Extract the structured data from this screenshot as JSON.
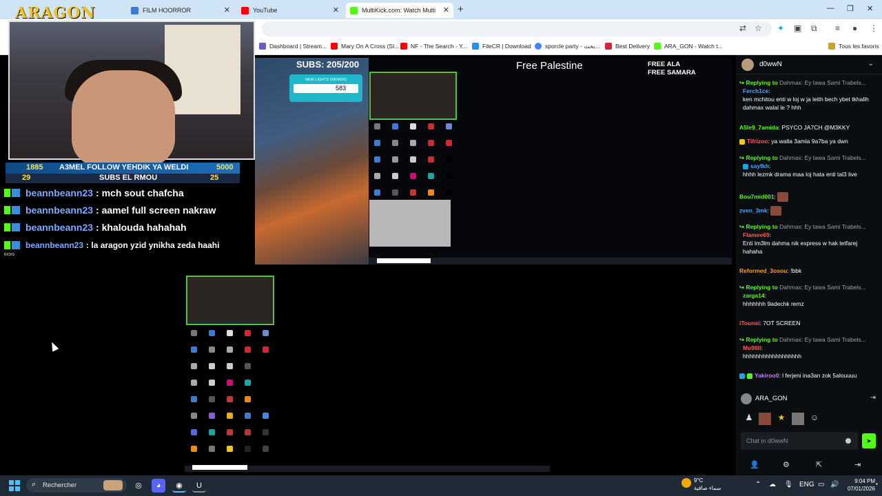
{
  "browser": {
    "tabs": [
      {
        "title": "FILM HOORROR",
        "color": "#3a7bd5"
      },
      {
        "title": "YouTube",
        "color": "#ff0000"
      },
      {
        "title": "MultiKick.com: Watch Multi",
        "color": "#53fc18"
      }
    ],
    "bookmarks": [
      {
        "label": "Dashboard | Stream...",
        "icon": "#6a5acd"
      },
      {
        "label": "Mary On A Cross (Sl...",
        "icon": "#ff0000"
      },
      {
        "label": "NF - The Search - Y...",
        "icon": "#ff0000"
      },
      {
        "label": "FileCR | Download",
        "icon": "#1e90ff"
      },
      {
        "label": "sporcle party - بحث...",
        "icon": "#4285f4"
      },
      {
        "label": "Best Delivery",
        "icon": "#d23"
      },
      {
        "label": "ARA_GON - Watch t...",
        "icon": "#53fc18"
      }
    ],
    "all_bookmarks": "Tous les favoris"
  },
  "stream": {
    "logo": "ARAGON",
    "subs": "SUBS: 205/200",
    "new_lights_label": "NEW LIGHTS (NEWER)",
    "new_lights_value": "583",
    "free_palestine": "Free Palestine",
    "free_ala": "FREE ALA",
    "free_samara": "FREE SAMARA",
    "goal1_left": "1885",
    "goal1_text": "A3MEL FOLLOW YEHDIK YA WELDI",
    "goal1_right": "5000",
    "goal2_left": "29",
    "goal2_text": "SUBS EL RMOU",
    "goal2_right": "25",
    "kicks": "KICKS",
    "overlay_chat": [
      {
        "user": "beannbeann23",
        "msg": ": mch sout chafcha"
      },
      {
        "user": "beannbeann23",
        "msg": ": aamel full screen nakraw"
      },
      {
        "user": "beannbeann23",
        "msg": ": khalouda hahahah"
      },
      {
        "user": "beannbeann23",
        "msg": ": la aragon yzid ynikha zeda haahi"
      }
    ]
  },
  "chat": {
    "channel": "d0wwN",
    "messages": [
      {
        "type": "reply",
        "reply_to": "Replying to",
        "reply_user": "Dahmax:",
        "reply_text": "Ey tawa Sami Trabels...",
        "user": "Ferch1ce",
        "user_color": "#4aa3ff",
        "text": "ken mchitou enti w loj w ja leith bech ybet tkhalih dahmax walal le ? hhh"
      },
      {
        "type": "msg",
        "user": "A5le9_7amida",
        "user_color": "#53fc18",
        "text": "PSYCO JA7CH @M3KKY"
      },
      {
        "type": "msg",
        "user": "Tifrizoo",
        "user_color": "#ff5a5a",
        "text": "ya walla 3amla 9a7ba ya dwn"
      },
      {
        "type": "reply",
        "reply_to": "Replying to",
        "reply_user": "Dahmax:",
        "reply_text": "Ey tawa Sami Trabels...",
        "user": "sayfkh",
        "user_color": "#4aa3ff",
        "text": "hhhh lezmk drama maa loj hata enti tal3 live"
      },
      {
        "type": "msg",
        "user": "Bou7mid001",
        "user_color": "#53fc18",
        "text": ""
      },
      {
        "type": "msg",
        "user": "zven_3mk",
        "user_color": "#4aa3ff",
        "text": ""
      },
      {
        "type": "reply",
        "reply_to": "Replying to",
        "reply_user": "Dahmax:",
        "reply_text": "Ey tawa Sami Trabels...",
        "user": "Flamee69",
        "user_color": "#ff5a5a",
        "text": "Enti lm3lm dahma nik express w hak tetfarej hahaha"
      },
      {
        "type": "msg",
        "user": "Reformed_3osou",
        "user_color": "#f0a030",
        "text": "!bbk"
      },
      {
        "type": "reply",
        "reply_to": "Replying to",
        "reply_user": "Dahmax:",
        "reply_text": "Ey tawa Sami Trabels...",
        "user": "zarga14",
        "user_color": "#53fc18",
        "text": "hhhhhhh 9adechk remz"
      },
      {
        "type": "msg",
        "user": "iTounsi",
        "user_color": "#ff5a5a",
        "text": "7OT SCREEN"
      },
      {
        "type": "reply",
        "reply_to": "Replying to",
        "reply_user": "Dahmax:",
        "reply_text": "Ey tawa Sami Trabels...",
        "user": "Mo9lili",
        "user_color": "#ff5a5a",
        "text": "hhhhhhhhhhhhhhhhhh"
      },
      {
        "type": "msg",
        "user": "Yakiroo0",
        "user_color": "#c77dff",
        "text": "l ferjeni ina3an zok 5alouuuu"
      }
    ],
    "current_user": "ARA_GON",
    "input_placeholder": "Chat in d0wwN"
  },
  "taskbar": {
    "search": "Rechercher",
    "temp": "9°C",
    "weather": "سماء صافية",
    "lang": "ENG",
    "time": "9:04 PM",
    "date": "07/01/2026"
  }
}
